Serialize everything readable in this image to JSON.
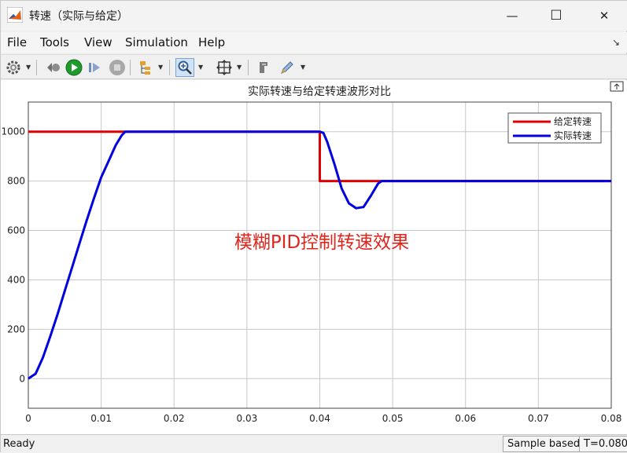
{
  "window": {
    "title": "转速（实际与给定）",
    "minimize_glyph": "—",
    "maximize_glyph": "☐",
    "close_glyph": "✕"
  },
  "menu": {
    "items": [
      "File",
      "Tools",
      "View",
      "Simulation",
      "Help"
    ],
    "overflow_glyph": "↘"
  },
  "toolbar": {
    "icons": [
      "settings-icon",
      "restore-icon",
      "run-icon",
      "step-forward-icon",
      "stop-icon",
      "signal-hierarchy-icon",
      "zoom-icon",
      "fit-to-view-icon",
      "highlight-icon",
      "style-icon"
    ]
  },
  "plot": {
    "title": "实际转速与给定转速波形对比",
    "annotation": "模糊PID控制转速效果",
    "annotation_color": "#e0261c",
    "legend": {
      "placement": "top-right",
      "entries": [
        "给定转速",
        "实际转速"
      ]
    }
  },
  "chart_data": {
    "type": "line",
    "title": "实际转速与给定转速波形对比",
    "xlabel": "",
    "ylabel": "",
    "xlim": [
      0,
      0.08
    ],
    "ylim": [
      -120,
      1120
    ],
    "xticks": [
      0,
      0.01,
      0.02,
      0.03,
      0.04,
      0.05,
      0.06,
      0.07,
      0.08
    ],
    "xtick_labels": [
      "0",
      "0.01",
      "0.02",
      "0.03",
      "0.04",
      "0.05",
      "0.06",
      "0.07",
      "0.08"
    ],
    "yticks": [
      0,
      200,
      400,
      600,
      800,
      1000
    ],
    "ytick_labels": [
      "0",
      "200",
      "400",
      "600",
      "800",
      "1000"
    ],
    "grid": true,
    "legend": "top-right",
    "series": [
      {
        "name": "给定转速",
        "color": "#e00000",
        "x": [
          0,
          0.0133,
          0.04,
          0.04,
          0.0485,
          0.08
        ],
        "y": [
          1000,
          1000,
          1000,
          800,
          800,
          800
        ]
      },
      {
        "name": "实际转速",
        "color": "#0000e0",
        "x": [
          0,
          0.001,
          0.002,
          0.003,
          0.004,
          0.005,
          0.006,
          0.007,
          0.008,
          0.009,
          0.01,
          0.011,
          0.012,
          0.0128,
          0.0133,
          0.0135,
          0.04,
          0.0405,
          0.041,
          0.042,
          0.043,
          0.044,
          0.045,
          0.046,
          0.047,
          0.048,
          0.0485,
          0.08
        ],
        "y": [
          0,
          20,
          85,
          170,
          260,
          355,
          450,
          545,
          640,
          730,
          815,
          880,
          945,
          985,
          1000,
          1000,
          1000,
          995,
          960,
          870,
          770,
          710,
          690,
          695,
          740,
          790,
          800,
          800
        ]
      }
    ]
  },
  "status": {
    "left": "Ready",
    "sample_mode": "Sample based",
    "time": "T=0.080"
  }
}
